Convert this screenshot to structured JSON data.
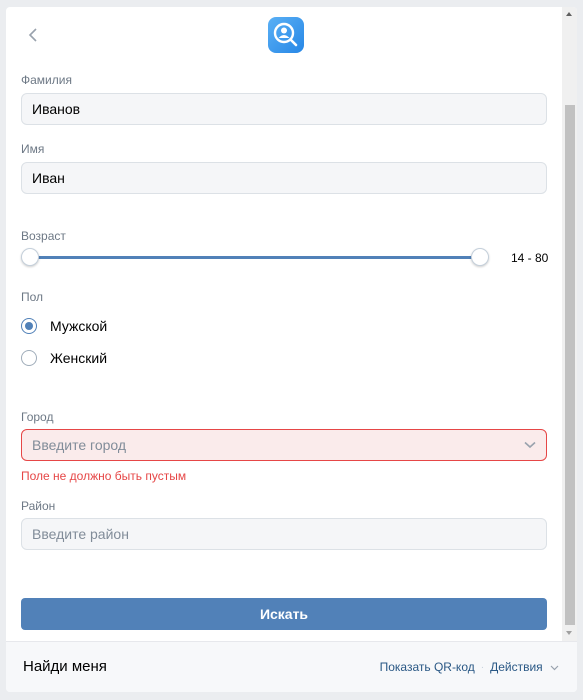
{
  "header": {
    "back_icon": "chevron-left-icon",
    "logo_icon": "person-search-icon",
    "logo_color": "#3f9bf0"
  },
  "form": {
    "surname": {
      "label": "Фамилия",
      "value": "Иванов"
    },
    "name": {
      "label": "Имя",
      "value": "Иван"
    },
    "age": {
      "label": "Возраст",
      "range_text": "14 - 80",
      "min": 14,
      "max": 80
    },
    "gender": {
      "label": "Пол",
      "options": [
        {
          "label": "Мужской",
          "checked": true
        },
        {
          "label": "Женский",
          "checked": false
        }
      ]
    },
    "city": {
      "label": "Город",
      "placeholder": "Введите город",
      "error": "Поле не должно быть пустым"
    },
    "district": {
      "label": "Район",
      "placeholder": "Введите район"
    },
    "submit_label": "Искать"
  },
  "footer": {
    "title": "Найди меня",
    "qr_label": "Показать QR-код",
    "actions_label": "Действия"
  },
  "colors": {
    "accent": "#5181b8",
    "error": "#e64646"
  }
}
